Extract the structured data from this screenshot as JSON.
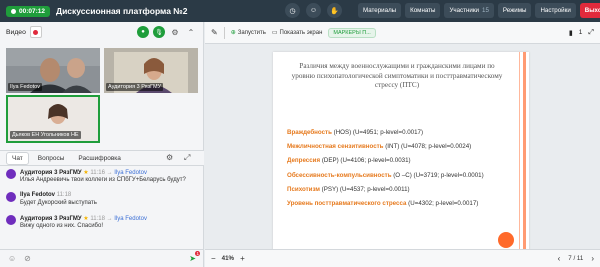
{
  "header": {
    "timer": "00:07:12",
    "title": "Дискуссионная платформа №2",
    "icons": [
      "clock-icon",
      "emoji-icon",
      "hand-icon"
    ],
    "menu": [
      {
        "label": "Материалы"
      },
      {
        "label": "Комнаты"
      },
      {
        "label": "Участники",
        "badge": "15"
      },
      {
        "label": "Режимы"
      },
      {
        "label": "Настройки"
      }
    ],
    "exit_label": "Выход"
  },
  "video": {
    "label": "Видео",
    "tiles": [
      {
        "name": "Ilya Fedotov"
      },
      {
        "name": "Аудитория 3 РязГМУ"
      },
      {
        "name": "Дьяков EH Угольников НЕ"
      }
    ]
  },
  "chat": {
    "tabs": [
      "Чат",
      "Вопросы",
      "Расшифровка"
    ],
    "messages": [
      {
        "sender": "Аудитория 3 РязГМУ",
        "time": "11:16",
        "to": "Ilya Fedotov",
        "text": "Илья Андреевичь твои коллеги из СПбГУ+Беларусь будут?"
      },
      {
        "sender": "Ilya Fedotov",
        "time": "11:18",
        "to": "",
        "text": "Будет Дукорский выступать"
      },
      {
        "sender": "Аудитория 3 РязГМУ",
        "time": "11:18",
        "to": "Ilya Fedotov",
        "text": "Вижу одного из них. Спасибо!"
      }
    ],
    "unread_badge": "1"
  },
  "presentation": {
    "toolbar": {
      "launch_label": "Запустить",
      "show_screen_label": "Показать экран",
      "marker_chip": "МАРКЕРЫ П...",
      "bookmark_count": "1"
    },
    "slide": {
      "title": "Различия между военнослужащими и гражданскими лицами по уровню психопатологической симптоматики и посттравматическому стрессу (ПТС)",
      "rows": [
        {
          "name": "Враждебность",
          "stats": "(HOS) (U=4951; p-level=0.0017)"
        },
        {
          "name": "Межличностная сензитивность",
          "stats": "(INT) (U=4078; p-level=0.0024)"
        },
        {
          "name": "Депрессия",
          "stats": "(DEP) (U=4106; p-level=0.0031)"
        },
        {
          "name": "Обсессивность-компульсивность",
          "stats": "(O –C) (U=3719; p-level=0.0001)"
        },
        {
          "name": "Психотизм",
          "stats": "(PSY) (U=4537; p-level=0.0011)"
        },
        {
          "name": "Уровень посттравматического стресса",
          "stats": "(U=4302; p-level=0.0017)"
        }
      ]
    },
    "zoom": "41%",
    "page": "7 / 11"
  }
}
